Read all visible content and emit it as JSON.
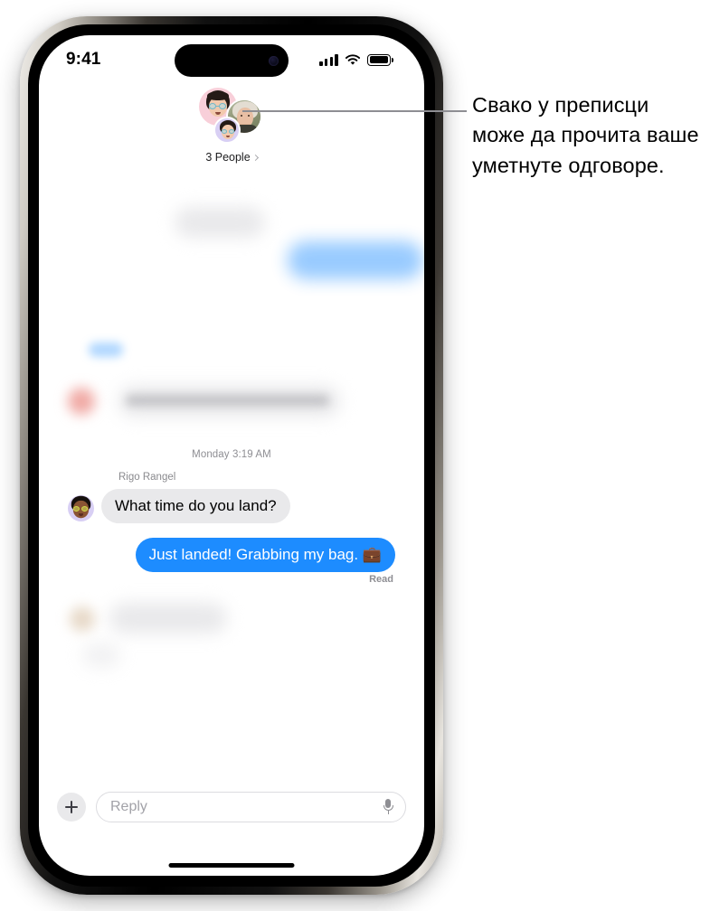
{
  "status_bar": {
    "time": "9:41",
    "signal_icon": "cellular-signal-icon",
    "wifi_icon": "wifi-icon",
    "battery_icon": "battery-icon"
  },
  "group_header": {
    "people_label": "3 People",
    "chevron_icon": "chevron-right-icon",
    "avatars": [
      {
        "name": "memoji-pink-avatar",
        "background": "#f8cfd9"
      },
      {
        "name": "photo-portrait-avatar",
        "background": "#8f9676"
      },
      {
        "name": "memoji-purple-avatar",
        "background": "#d8cff4"
      }
    ]
  },
  "conversation": {
    "timestamp": "Monday 3:19 AM",
    "sender_name": "Rigo Rangel",
    "incoming_message": "What time do you land?",
    "outgoing_message": "Just landed! Grabbing my bag. 💼",
    "read_receipt": "Read",
    "bubble_in_color": "#e9e9eb",
    "bubble_out_color": "#1d8cff"
  },
  "input_bar": {
    "add_label": "+",
    "reply_placeholder": "Reply",
    "mic_icon": "microphone-icon",
    "plus_icon": "plus-icon"
  },
  "callout": {
    "text": "Свако у преписци може да прочита ваше уметнуте одговоре."
  }
}
